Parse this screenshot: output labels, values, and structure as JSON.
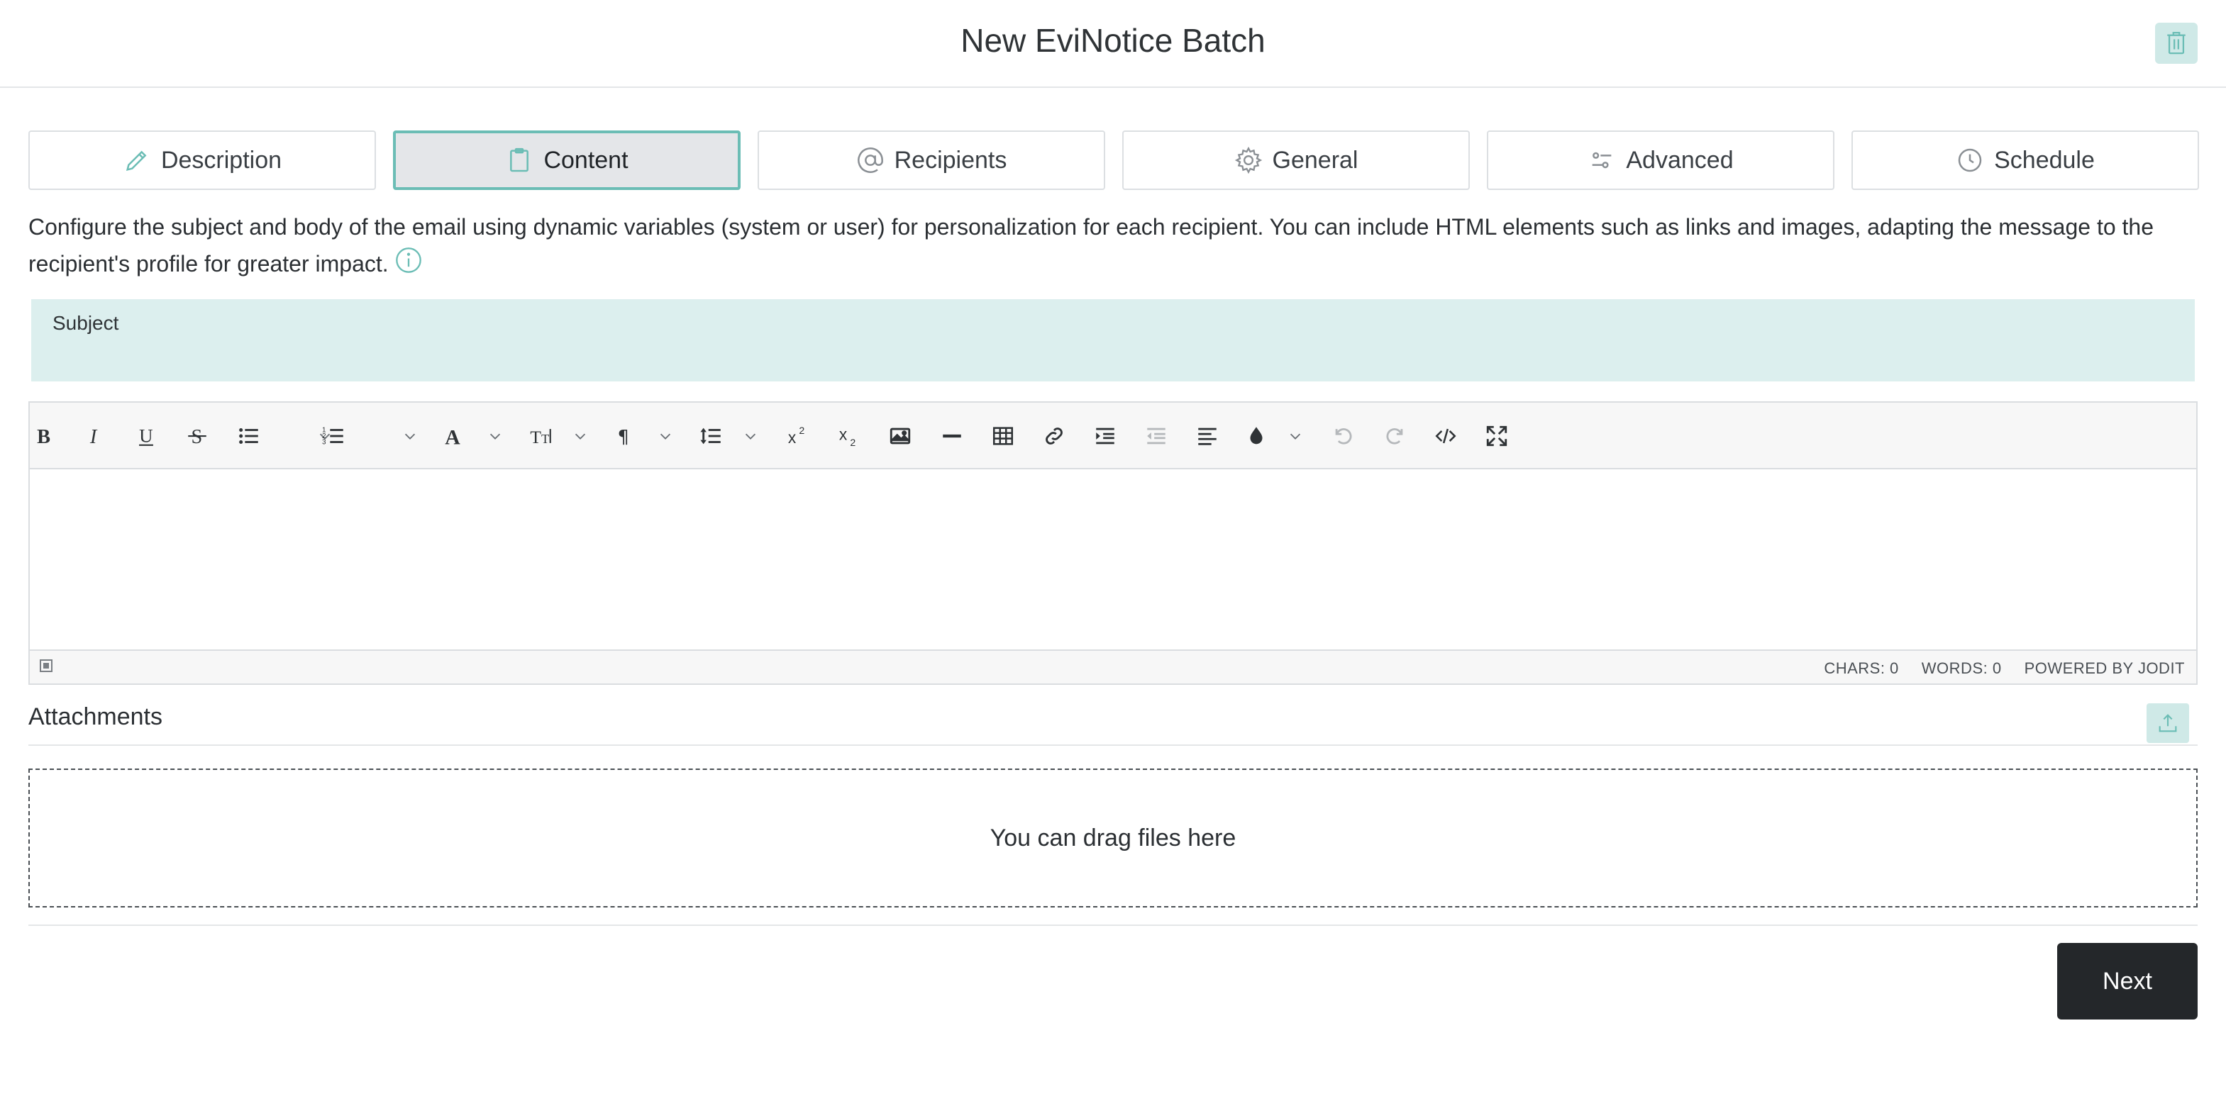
{
  "header": {
    "title": "New EviNotice Batch",
    "delete_icon": "trash-icon"
  },
  "tabs": [
    {
      "label": "Description",
      "icon": "pencil-icon",
      "active": false
    },
    {
      "label": "Content",
      "icon": "clipboard-icon",
      "active": true
    },
    {
      "label": "Recipients",
      "icon": "at-sign-icon",
      "active": false
    },
    {
      "label": "General",
      "icon": "gear-icon",
      "active": false
    },
    {
      "label": "Advanced",
      "icon": "sliders-icon",
      "active": false
    },
    {
      "label": "Schedule",
      "icon": "clock-icon",
      "active": false
    }
  ],
  "description": {
    "text": "Configure the subject and body of the email using dynamic variables (system or user) for personalization for each recipient. You can include HTML elements such as links and images, adapting the message to the recipient's profile for greater impact.",
    "info_icon": "info-icon"
  },
  "subject": {
    "label": "Subject",
    "value": ""
  },
  "editor": {
    "toolbar": [
      "bold",
      "italic",
      "underline",
      "strikethrough",
      "bulleted-list",
      "numbered-list",
      "font",
      "font-size",
      "paragraph",
      "line-height",
      "superscript",
      "subscript",
      "image",
      "horizontal-rule",
      "table",
      "link",
      "indent",
      "outdent",
      "align",
      "brush",
      "undo",
      "redo",
      "source",
      "fullsize"
    ],
    "chars": "CHARS: 0",
    "words": "WORDS: 0",
    "powered_by": "POWERED BY JODIT"
  },
  "attachments": {
    "title": "Attachments",
    "dropzone_text": "You can drag files here",
    "upload_icon": "upload-icon"
  },
  "actions": {
    "next_label": "Next"
  },
  "colors": {
    "accent": "#6bbdb5",
    "accent_bg": "#cfe9e7",
    "subject_bg": "#dcefee",
    "primary_button": "#24272a"
  }
}
